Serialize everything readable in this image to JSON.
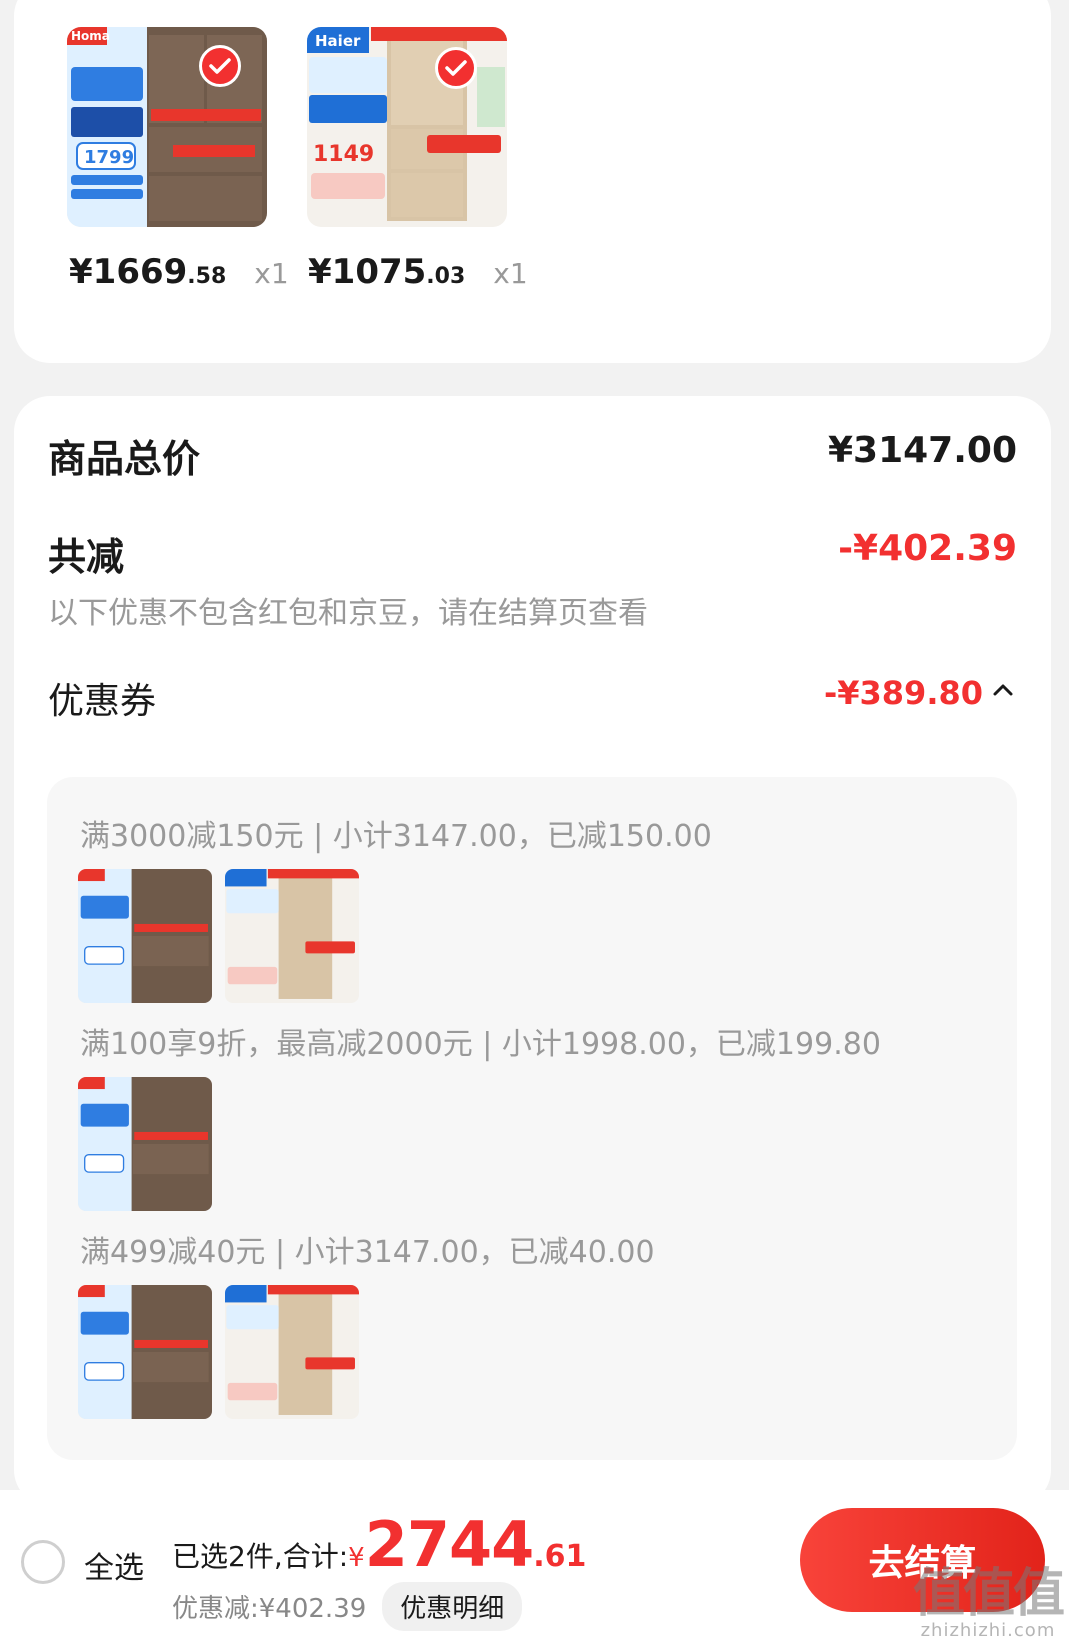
{
  "products": [
    {
      "brand": "Homa",
      "promo_price": "1799",
      "price_int": "¥1669",
      "price_dec": ".58",
      "qty": "x1",
      "thumb_bg": "#6f5a4a",
      "thumb_accent": "#2f7de1"
    },
    {
      "brand": "Haier",
      "promo_price": "1149",
      "price_int": "¥1075",
      "price_dec": ".03",
      "qty": "x1",
      "thumb_bg": "#d8c4a6",
      "thumb_accent": "#1f6fd6"
    }
  ],
  "summary": {
    "total_label": "商品总价",
    "total_value": "¥3147.00",
    "reduce_label": "共减",
    "reduce_value": "-¥402.39",
    "reduce_note": "以下优惠不包含红包和京豆，请在结算页查看",
    "coupon_label": "优惠券",
    "coupon_value": "-¥389.80",
    "coupon_toggle_icon": "chevron-up-icon"
  },
  "rules": [
    {
      "text": "满3000减150元 | 小计3147.00，已减150.00"
    },
    {
      "text": "满100享9折，最高减2000元 | 小计1998.00，已减199.80"
    },
    {
      "text": "满499减40元 | 小计3147.00，已减40.00"
    }
  ],
  "bottom": {
    "select_all": "全选",
    "selected_label": "已选2件,合计:",
    "currency": "¥",
    "total_int": "2744",
    "total_dec": ".61",
    "discount_label": "优惠减:¥402.39",
    "detail_button": "优惠明细",
    "checkout_button": "去结算"
  },
  "watermark": {
    "glyph": "值值值",
    "url": "zhizhizhi.com"
  },
  "colors": {
    "accent_red": "#f23030",
    "muted": "#999999",
    "card": "#ffffff",
    "page": "#f2f2f2"
  }
}
